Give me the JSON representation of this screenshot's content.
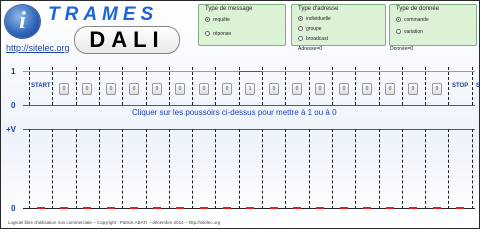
{
  "header": {
    "logo_letter": "i",
    "title_top": "TRAMES",
    "title_main": "DALI",
    "site_link": "http://sitelec.org"
  },
  "message_type": {
    "title": "Type de message",
    "options": [
      {
        "label": "requête",
        "selected": true
      },
      {
        "label": "réponse",
        "selected": false
      }
    ]
  },
  "address_type": {
    "title": "Type d'adresse",
    "options": [
      {
        "label": "individuelle",
        "selected": true
      },
      {
        "label": "groupe",
        "selected": false
      },
      {
        "label": "broadcast",
        "selected": false
      }
    ]
  },
  "data_type": {
    "title": "Type de donnée",
    "options": [
      {
        "label": "commande",
        "selected": true
      },
      {
        "label": "variation",
        "selected": false
      }
    ]
  },
  "readouts": {
    "address": "Adresse=0",
    "data": "Donnée=0"
  },
  "logic_scale": {
    "high": "1",
    "low": "0"
  },
  "voltage_scale": {
    "high": "+V",
    "low": "0"
  },
  "frame": {
    "start_label": "START",
    "stop_labels": [
      "STOP",
      "STOP"
    ],
    "bits": [
      "0",
      "0",
      "0",
      "0",
      "0",
      "0",
      "0",
      "0",
      "1",
      "0",
      "0",
      "0",
      "0",
      "0",
      "0",
      "0",
      "0"
    ]
  },
  "hint": "Cliquer sur les poussoirs ci-dessus pour mettre à 1 ou à 0",
  "footer": "Logiciel libre d'utilisation non commerciale – Copyright : Patrick ABATI – décembre 2014 – http://sitelec.org",
  "colors": {
    "signal": "#e02020",
    "accent": "#1d64d8",
    "panel": "#dcf2d6"
  }
}
